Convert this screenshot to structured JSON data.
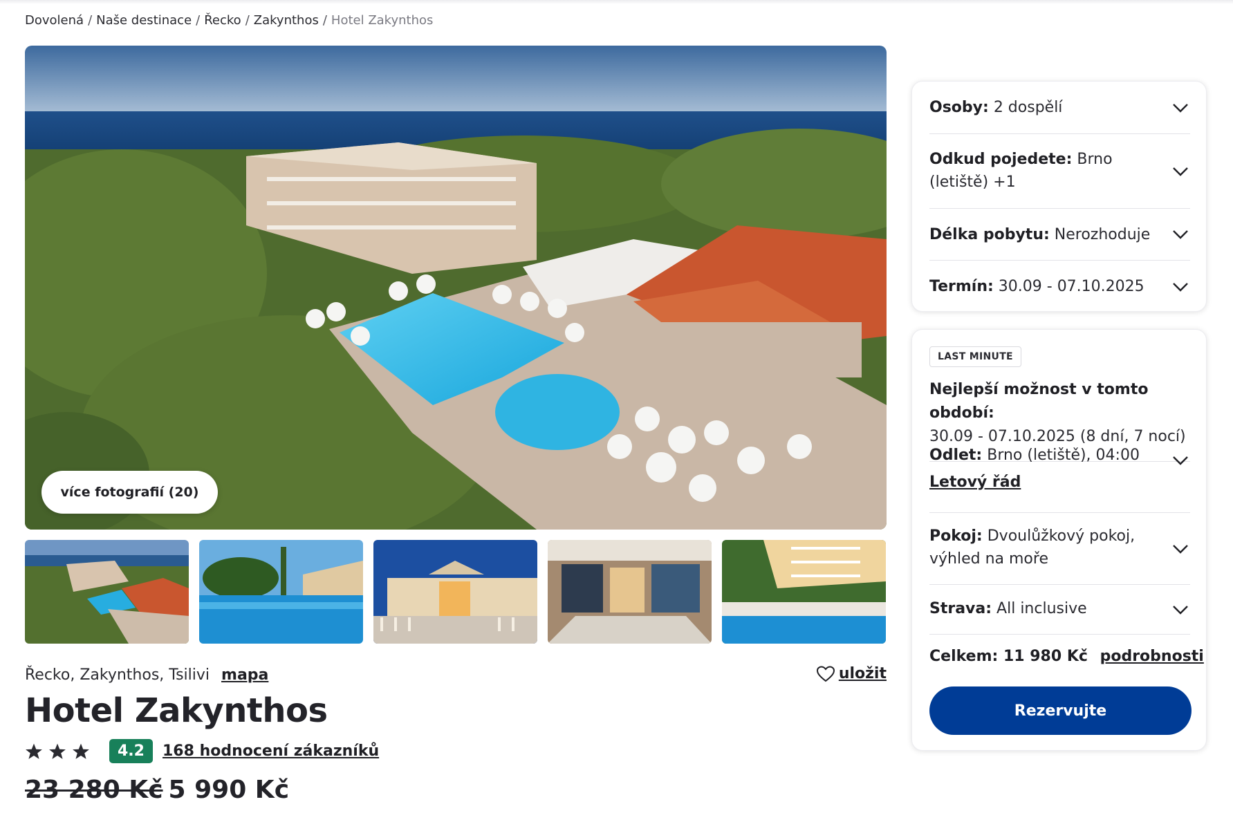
{
  "breadcrumb": {
    "items": [
      "Dovolená",
      "Naše destinace",
      "Řecko",
      "Zakynthos"
    ],
    "current": "Hotel Zakynthos",
    "separator": "/"
  },
  "gallery": {
    "more_photos_label": "více fotografií (20)",
    "thumbnails": [
      "hotel-aerial",
      "pool-and-pines",
      "restaurant-night",
      "lobby-terrace",
      "pool-with-loungers"
    ]
  },
  "hotel": {
    "location": "Řecko, Zakynthos, Tsilivi",
    "map_label": "mapa",
    "save_label": "uložit",
    "name": "Hotel Zakynthos",
    "stars": 3,
    "score": "4.2",
    "reviews_label": "168 hodnocení zákazníků",
    "old_price": "23 280 Kč",
    "price": "5 990 Kč",
    "score_color": "#18805a"
  },
  "params": {
    "persons": {
      "label": "Osoby:",
      "value": "2 dospělí"
    },
    "departure": {
      "label": "Odkud pojedete:",
      "value": "Brno (letiště) +1"
    },
    "length": {
      "label": "Délka pobytu:",
      "value": "Nerozhoduje"
    },
    "term": {
      "label": "Termín:",
      "value": "30.09 - 07.10.2025"
    }
  },
  "offer": {
    "badge": "LAST MINUTE",
    "best_label": "Nejlepší možnost v tomto období:",
    "best_value": "30.09 - 07.10.2025 (8 dní, 7 nocí)",
    "flight": {
      "label": "Odlet:",
      "value": "Brno (letiště), 04:00",
      "link": "Letový řád"
    },
    "room": {
      "label": "Pokoj:",
      "value": "Dvoulůžkový pokoj, výhled na moře"
    },
    "board": {
      "label": "Strava:",
      "value": "All inclusive"
    },
    "total": {
      "label": "Celkem:",
      "value": "11 980 Kč",
      "details": "podrobnosti"
    },
    "book_label": "Rezervujte",
    "button_color": "#003c96"
  }
}
